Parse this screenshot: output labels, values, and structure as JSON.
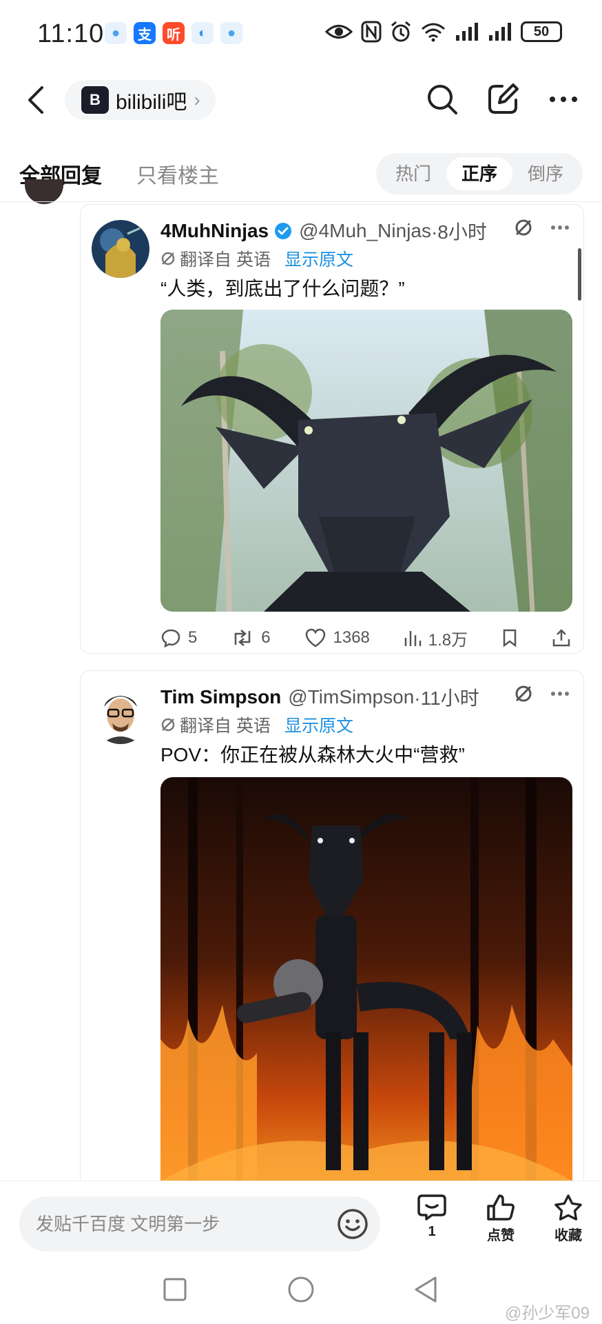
{
  "status_bar": {
    "time": "11:10",
    "apps": [
      {
        "icon": "baidu-netdisk-icon",
        "color": "#4aa3f0",
        "glyph": "●"
      },
      {
        "icon": "alipay-icon",
        "color": "#1677ff",
        "glyph": "支"
      },
      {
        "icon": "ting-icon",
        "color": "#ff4a2b",
        "glyph": "听"
      },
      {
        "icon": "browser-icon",
        "color": "#2f8ff0",
        "glyph": "◐"
      },
      {
        "icon": "baidu-netdisk-icon",
        "color": "#4aa3f0",
        "glyph": "●"
      }
    ],
    "battery": "50",
    "signal_label": "6"
  },
  "nav": {
    "forum_name": "bilibili吧",
    "forum_logo_glyph": "B"
  },
  "tabs": {
    "all_replies": "全部回复",
    "op_only": "只看楼主",
    "sort": [
      "热门",
      "正序",
      "倒序"
    ],
    "active_sort_index": 1
  },
  "posts": [
    {
      "name": "4MuhNinjas",
      "verified": true,
      "handle": "@4Muh_Ninjas",
      "time": "·8小时",
      "translate_label": "翻译自 英语",
      "show_original": "显示原文",
      "text": "“人类，到底出了什么问题？”",
      "image_desc_icon": "goat-robot-image",
      "actions": {
        "replies": "5",
        "retweets": "6",
        "likes": "1368",
        "views": "1.8万"
      }
    },
    {
      "name": "Tim Simpson",
      "verified": false,
      "handle": "@TimSimpson",
      "time": "·11小时",
      "translate_label": "翻译自 英语",
      "show_original": "显示原文",
      "text": "POV：你正在被从森林大火中“营救”",
      "image_desc_icon": "forest-fire-robot-image"
    }
  ],
  "bottom_bar": {
    "reply_placeholder": "发贴千百度 文明第一步",
    "comment_count": "1",
    "like_label": "点赞",
    "favorite_label": "收藏"
  },
  "watermark": "@孙少军09",
  "colors": {
    "link": "#1d8fe0",
    "verified": "#1d9bf0",
    "sort_bg": "#f2f3f5"
  }
}
